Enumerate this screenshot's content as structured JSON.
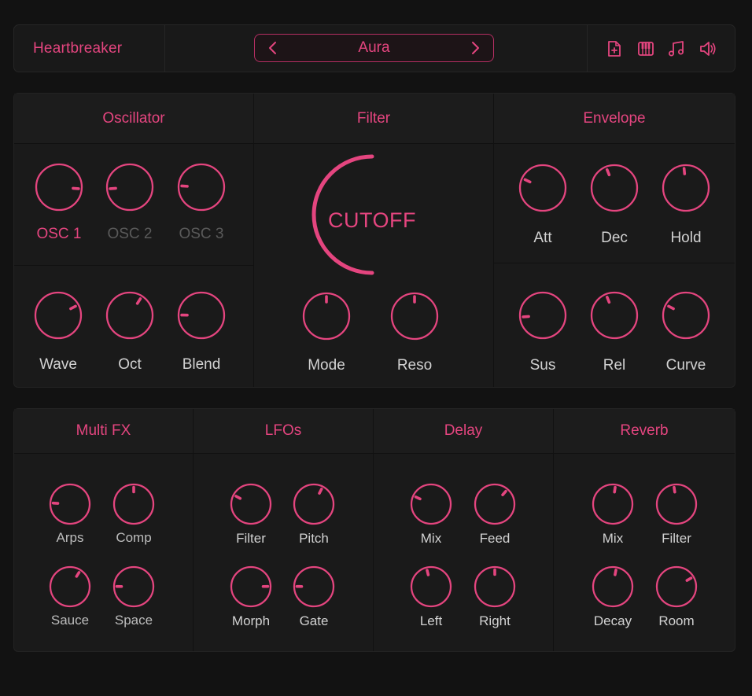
{
  "app": {
    "name": "Heartbreaker"
  },
  "preset": {
    "name": "Aura",
    "prev_icon": "chevron-left-icon",
    "next_icon": "chevron-right-icon"
  },
  "toolbar": {
    "icons": [
      "new-file-icon",
      "piano-keys-icon",
      "music-note-icon",
      "speaker-icon"
    ]
  },
  "colors": {
    "accent": "#e4457f",
    "background": "#121212",
    "panel": "#1a1a1a",
    "label": "#d2d2d2",
    "inactive": "#5a5a5a"
  },
  "sections": {
    "oscillator": {
      "title": "Oscillator",
      "osc_selector": [
        {
          "label": "OSC 1",
          "active": true,
          "value": 0.85
        },
        {
          "label": "OSC 2",
          "active": false,
          "value": 0.15
        },
        {
          "label": "OSC 3",
          "active": false,
          "value": 0.18
        }
      ],
      "knobs": [
        {
          "label": "Wave",
          "value": 0.73
        },
        {
          "label": "Oct",
          "value": 0.62
        },
        {
          "label": "Blend",
          "value": 0.17
        }
      ]
    },
    "filter": {
      "title": "Filter",
      "cutoff": {
        "label": "CUTOFF",
        "value": 0.5
      },
      "knobs": [
        {
          "label": "Mode",
          "value": 0.5
        },
        {
          "label": "Reso",
          "value": 0.5
        }
      ]
    },
    "envelope": {
      "title": "Envelope",
      "knobs": [
        {
          "label": "Att",
          "value": 0.26
        },
        {
          "label": "Dec",
          "value": 0.42
        },
        {
          "label": "Hold",
          "value": 0.48
        },
        {
          "label": "Sus",
          "value": 0.15
        },
        {
          "label": "Rel",
          "value": 0.42
        },
        {
          "label": "Curve",
          "value": 0.27
        }
      ]
    },
    "multifx": {
      "title": "Multi FX",
      "knobs": [
        {
          "label": "Arps",
          "value": 0.18
        },
        {
          "label": "Comp",
          "value": 0.5
        },
        {
          "label": "Sauce",
          "value": 0.62
        },
        {
          "label": "Space",
          "value": 0.17
        }
      ]
    },
    "lfos": {
      "title": "LFOs",
      "knobs": [
        {
          "label": "Filter",
          "value": 0.27
        },
        {
          "label": "Pitch",
          "value": 0.6
        },
        {
          "label": "Morph",
          "value": 0.83
        },
        {
          "label": "Gate",
          "value": 0.17
        }
      ]
    },
    "delay": {
      "title": "Delay",
      "knobs": [
        {
          "label": "Mix",
          "value": 0.26
        },
        {
          "label": "Feed",
          "value": 0.65
        },
        {
          "label": "Left",
          "value": 0.45
        },
        {
          "label": "Right",
          "value": 0.5
        }
      ]
    },
    "reverb": {
      "title": "Reverb",
      "knobs": [
        {
          "label": "Mix",
          "value": 0.53
        },
        {
          "label": "Filter",
          "value": 0.47
        },
        {
          "label": "Decay",
          "value": 0.54
        },
        {
          "label": "Room",
          "value": 0.72
        }
      ]
    }
  }
}
